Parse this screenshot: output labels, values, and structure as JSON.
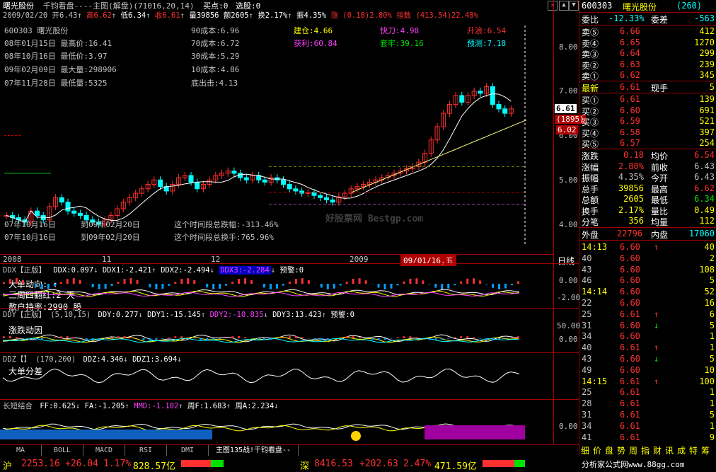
{
  "title_bar": {
    "stock_name": "曙光股份",
    "mode": "千钧看盘----主图(解盘)",
    "params": "(71016,20,14)",
    "buy_point": "买点:0",
    "select_stock": "选股:0"
  },
  "info_line": {
    "date": "2009/02/20",
    "open": "开6.43",
    "high": "高6.62",
    "low": "低6.34",
    "close": "收6.61",
    "volume": "量39856",
    "amount": "额2605",
    "turnover": "换2.17%",
    "amplitude": "振4.35%",
    "change": "涨 (0.18)2.80%",
    "index": "指数 (413.54)22.48%"
  },
  "overlay_info": {
    "code_name": "600303  曙光股份",
    "high_date": "08年01月15日  最高价:16.41",
    "low_date": "08年10月16日  最低价:3.97",
    "max_vol": "09年02月09日  最大量:298906",
    "min_vol": "07年11月28日  最低量:5325",
    "cost90": "90成本:6.96",
    "cost70": "70成本:6.72",
    "cost30": "30成本:5.29",
    "cost10": "10成本:4.86",
    "bottom": "底出击:4.13",
    "position": "建仓:4.66",
    "profit": "获利:60.84",
    "quick": "快刀:4.98",
    "trapped": "套牢:39.16",
    "rise": "升浪:6.54",
    "predict": "预测:7.18"
  },
  "period_stats": {
    "from1": "07年10月16日",
    "to1": "到09年02月20日",
    "stat1": "这个时间段总跌幅:-313.46%",
    "from2": "07年10月16日",
    "to2": "到09年02月20日",
    "stat2": "这个时间段总换手:765.96%"
  },
  "price_axis": [
    "8.00",
    "7.00",
    "6.00",
    "5.00",
    "4.00"
  ],
  "price_label": "6.61",
  "vol_label": "(1895)",
  "price_label2": "6.02",
  "time_axis": [
    "2008",
    "11",
    "12",
    "2009",
    "09/01/16,五"
  ],
  "period_btn": "日线",
  "watermark": "好股票网 Bestgp.com",
  "ddx_panel": {
    "header": "DDX【正版】",
    "ddx": "DDX:0.097",
    "ddx1": "DDX1:-2.421",
    "ddx2": "DDX2:-2.494",
    "ddx3": "DDX3:-2.284",
    "alert": "预警:0",
    "label1": "大单动向: ↑",
    "label2": "三周四翻红:2 天",
    "label3": "散户持率:2990 股",
    "axis": [
      "0.00",
      "-2.00"
    ]
  },
  "ddy_panel": {
    "header": "DDY【正版】",
    "params": "(5,10,15)",
    "ddy": "DDY:0.277",
    "ddy1": "DDY1:-15.145",
    "ddy2": "DDY2:-10.835",
    "ddy3": "DDY3:13.423",
    "alert": "预警:0",
    "label": "涨跌动因",
    "axis": [
      "50.00",
      "0.00"
    ]
  },
  "ddz_panel": {
    "header": "DDZ【】",
    "params": "(170,200)",
    "ddz": "DDZ:4.346",
    "ddz1": "DDZ1:3.694",
    "label": "大单分差"
  },
  "long_short_panel": {
    "header": "长短结合",
    "ff": "FF:0.625",
    "fa": "FA:-1.205",
    "mmd": "MMD:-1.102",
    "zhouf": "周F:1.683",
    "zhoua": "周A:2.234",
    "axis": [
      "0.00"
    ]
  },
  "tabs": [
    "MA",
    "BOLL",
    "MACD",
    "RSI",
    "DMI",
    "主图135战!千钧看盘--"
  ],
  "quote": {
    "code": "600303",
    "name": "曙光股份",
    "num": "(260)",
    "weibi_label": "委比",
    "weibi": "-12.33%",
    "weicha_label": "委差",
    "weicha": "-563",
    "sell": [
      {
        "label": "卖⑤",
        "price": "6.66",
        "vol": "412"
      },
      {
        "label": "卖④",
        "price": "6.65",
        "vol": "1270"
      },
      {
        "label": "卖③",
        "price": "6.64",
        "vol": "299"
      },
      {
        "label": "卖②",
        "price": "6.63",
        "vol": "239"
      },
      {
        "label": "卖①",
        "price": "6.62",
        "vol": "345"
      }
    ],
    "latest_label": "最新",
    "latest": "6.61",
    "now_hand_label": "现手",
    "now_hand": "5",
    "buy": [
      {
        "label": "买①",
        "price": "6.61",
        "vol": "139"
      },
      {
        "label": "买②",
        "price": "6.60",
        "vol": "691"
      },
      {
        "label": "买③",
        "price": "6.59",
        "vol": "521"
      },
      {
        "label": "买④",
        "price": "6.58",
        "vol": "397"
      },
      {
        "label": "买⑤",
        "price": "6.57",
        "vol": "254"
      }
    ],
    "stats": [
      {
        "l1": "涨跌",
        "v1": "0.18",
        "l2": "均价",
        "v2": "6.54",
        "c1": "red",
        "c2": "red"
      },
      {
        "l1": "涨幅",
        "v1": "2.80%",
        "l2": "前收",
        "v2": "6.43",
        "c1": "red",
        "c2": "gray"
      },
      {
        "l1": "振幅",
        "v1": "4.35%",
        "l2": "今开",
        "v2": "6.43",
        "c1": "gray",
        "c2": "gray"
      },
      {
        "l1": "总手",
        "v1": "39856",
        "l2": "最高",
        "v2": "6.62",
        "c1": "yellow",
        "c2": "red"
      },
      {
        "l1": "总额",
        "v1": "2605",
        "l2": "最低",
        "v2": "6.34",
        "c1": "yellow",
        "c2": "green"
      },
      {
        "l1": "换手",
        "v1": "2.17%",
        "l2": "量比",
        "v2": "0.49",
        "c1": "yellow",
        "c2": "yellow"
      },
      {
        "l1": "分笔",
        "v1": "356",
        "l2": "均量",
        "v2": "112",
        "c1": "yellow",
        "c2": "yellow"
      }
    ],
    "outer_label": "外盘",
    "outer": "22796",
    "inner_label": "内盘",
    "inner": "17060"
  },
  "ticks": [
    {
      "time": "14:13",
      "price": "6.60",
      "dir": "↑",
      "vol": "40",
      "dc": "red"
    },
    {
      "time": "40",
      "price": "6.60",
      "dir": "",
      "vol": "2",
      "dc": "red"
    },
    {
      "time": "43",
      "price": "6.60",
      "dir": "",
      "vol": "108",
      "dc": "red"
    },
    {
      "time": "46",
      "price": "6.60",
      "dir": "",
      "vol": "5",
      "dc": "red"
    },
    {
      "time": "14:14",
      "price": "6.60",
      "dir": "",
      "vol": "52",
      "dc": "red"
    },
    {
      "time": "22",
      "price": "6.60",
      "dir": "",
      "vol": "16",
      "dc": "red"
    },
    {
      "time": "25",
      "price": "6.61",
      "dir": "↑",
      "vol": "6",
      "dc": "red"
    },
    {
      "time": "31",
      "price": "6.60",
      "dir": "↓",
      "vol": "5",
      "dc": "green"
    },
    {
      "time": "34",
      "price": "6.60",
      "dir": "",
      "vol": "1",
      "dc": "green"
    },
    {
      "time": "40",
      "price": "6.61",
      "dir": "↑",
      "vol": "1",
      "dc": "red"
    },
    {
      "time": "43",
      "price": "6.60",
      "dir": "↓",
      "vol": "5",
      "dc": "green"
    },
    {
      "time": "49",
      "price": "6.60",
      "dir": "",
      "vol": "10",
      "dc": "green"
    },
    {
      "time": "14:15",
      "price": "6.61",
      "dir": "↑",
      "vol": "100",
      "dc": "red"
    },
    {
      "time": "25",
      "price": "6.61",
      "dir": "",
      "vol": "1",
      "dc": "red"
    },
    {
      "time": "28",
      "price": "6.61",
      "dir": "",
      "vol": "1",
      "dc": "red"
    },
    {
      "time": "31",
      "price": "6.61",
      "dir": "",
      "vol": "5",
      "dc": "red"
    },
    {
      "time": "34",
      "price": "6.61",
      "dir": "",
      "vol": "1",
      "dc": "red"
    },
    {
      "time": "41",
      "price": "6.61",
      "dir": "",
      "vol": "9",
      "dc": "red"
    }
  ],
  "bottom_tabs": [
    "细",
    "价",
    "盘",
    "势",
    "周",
    "指",
    "财",
    "讯",
    "成",
    "特",
    "筹"
  ],
  "statusbar": {
    "sh_label": "沪",
    "sh_index": "2253.16",
    "sh_change": "+26.04",
    "sh_pct": "1.17%",
    "sh_amount": "828.57亿",
    "sz_label": "深",
    "sz_index": "8416.53",
    "sz_change": "+202.63",
    "sz_pct": "2.47%",
    "sz_amount": "471.59亿",
    "site": "分析家公式网www.88gg.com"
  },
  "colors": {
    "up": "#ff3030",
    "down": "#00ffff",
    "bg": "#000000",
    "border": "#a00000"
  }
}
